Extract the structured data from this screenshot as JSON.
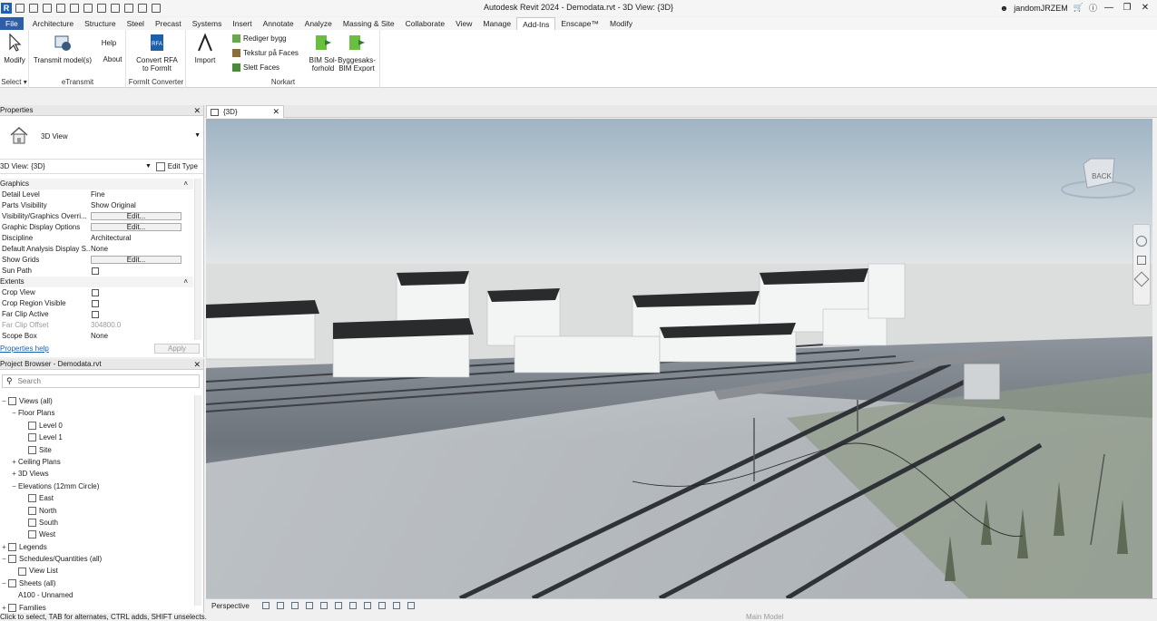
{
  "app": {
    "window_title": "Autodesk Revit 2024 - Demodata.rvt - 3D View: {3D}",
    "user": "jandomJRZEM"
  },
  "ribbon_tabs": [
    "File",
    "Architecture",
    "Structure",
    "Steel",
    "Precast",
    "Systems",
    "Insert",
    "Annotate",
    "Analyze",
    "Massing & Site",
    "Collaborate",
    "View",
    "Manage",
    "Add-Ins",
    "Enscape™",
    "Modify"
  ],
  "active_tab": "Add-Ins",
  "ribbon": {
    "modify_label": "Modify",
    "select_label": "Select ▾",
    "transmit_label": "Transmit model(s)",
    "help_label": "Help",
    "about_label": "About",
    "etransmit_group": "eTransmit",
    "convert_label_1": "Convert RFA",
    "convert_label_2": "to FormIt",
    "formit_group": "FormIt Converter",
    "import_label": "Import",
    "rediger_label": "Rediger bygg",
    "tekstur_label": "Tekstur på Faces",
    "slett_label": "Slett Faces",
    "norkart_group": "Norkart",
    "bim_sol_1": "BIM Sol-",
    "bim_sol_2": "forhold",
    "byggesaks_1": "Byggesaks-",
    "byggesaks_2": "BIM Export"
  },
  "properties": {
    "title": "Properties",
    "type_name": "3D View",
    "view_selector": "3D View: {3D}",
    "edit_type": "Edit Type",
    "rows": [
      {
        "k": "Graphics",
        "v": "",
        "kind": "section"
      },
      {
        "k": "Detail Level",
        "v": "Fine",
        "kind": "text"
      },
      {
        "k": "Parts Visibility",
        "v": "Show Original",
        "kind": "text"
      },
      {
        "k": "Visibility/Graphics Overri...",
        "v": "Edit...",
        "kind": "button"
      },
      {
        "k": "Graphic Display Options",
        "v": "Edit...",
        "kind": "button"
      },
      {
        "k": "Discipline",
        "v": "Architectural",
        "kind": "text"
      },
      {
        "k": "Default Analysis Display S...",
        "v": "None",
        "kind": "text"
      },
      {
        "k": "Show Grids",
        "v": "Edit...",
        "kind": "button"
      },
      {
        "k": "Sun Path",
        "v": "",
        "kind": "check"
      },
      {
        "k": "Extents",
        "v": "",
        "kind": "section"
      },
      {
        "k": "Crop View",
        "v": "",
        "kind": "check"
      },
      {
        "k": "Crop Region Visible",
        "v": "",
        "kind": "check"
      },
      {
        "k": "Far Clip Active",
        "v": "",
        "kind": "check"
      },
      {
        "k": "Far Clip Offset",
        "v": "304800.0",
        "kind": "dim"
      },
      {
        "k": "Scope Box",
        "v": "None",
        "kind": "text"
      }
    ],
    "help_link": "Properties help",
    "apply": "Apply"
  },
  "browser": {
    "title": "Project Browser - Demodata.rvt",
    "search_placeholder": "Search",
    "tree": [
      {
        "label": "Views (all)",
        "indent": 0,
        "toggle": "−",
        "icon": true
      },
      {
        "label": "Floor Plans",
        "indent": 1,
        "toggle": "−",
        "icon": false
      },
      {
        "label": "Level 0",
        "indent": 2,
        "toggle": "",
        "icon": true
      },
      {
        "label": "Level 1",
        "indent": 2,
        "toggle": "",
        "icon": true
      },
      {
        "label": "Site",
        "indent": 2,
        "toggle": "",
        "icon": true
      },
      {
        "label": "Ceiling Plans",
        "indent": 1,
        "toggle": "+",
        "icon": false
      },
      {
        "label": "3D Views",
        "indent": 1,
        "toggle": "+",
        "icon": false
      },
      {
        "label": "Elevations (12mm Circle)",
        "indent": 1,
        "toggle": "−",
        "icon": false
      },
      {
        "label": "East",
        "indent": 2,
        "toggle": "",
        "icon": true
      },
      {
        "label": "North",
        "indent": 2,
        "toggle": "",
        "icon": true
      },
      {
        "label": "South",
        "indent": 2,
        "toggle": "",
        "icon": true
      },
      {
        "label": "West",
        "indent": 2,
        "toggle": "",
        "icon": true
      },
      {
        "label": "Legends",
        "indent": 0,
        "toggle": "+",
        "icon": true
      },
      {
        "label": "Schedules/Quantities (all)",
        "indent": 0,
        "toggle": "−",
        "icon": true
      },
      {
        "label": "View List",
        "indent": 1,
        "toggle": "",
        "icon": true
      },
      {
        "label": "Sheets (all)",
        "indent": 0,
        "toggle": "−",
        "icon": true
      },
      {
        "label": "A100 - Unnamed",
        "indent": 1,
        "toggle": "",
        "icon": false
      },
      {
        "label": "Families",
        "indent": 0,
        "toggle": "+",
        "icon": true
      }
    ]
  },
  "view": {
    "tab_label": "{3D}",
    "navcube_label": "BACK",
    "view_mode": "Perspective"
  },
  "status": {
    "hint": "Click to select, TAB for alternates, CTRL adds, SHIFT unselects.",
    "model": "Main Model"
  },
  "colors": {
    "accent": "#2c5fa8",
    "sky_top": "#9fb4c4",
    "sky_bottom": "#e4e7e8"
  }
}
